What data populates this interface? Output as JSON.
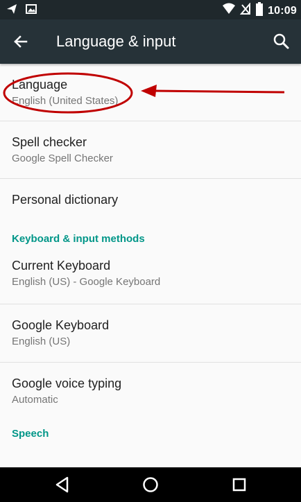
{
  "status_bar": {
    "time": "10:09",
    "icons": [
      "send-icon",
      "image-icon",
      "wifi-icon",
      "no-sim-icon",
      "battery-icon"
    ]
  },
  "app_bar": {
    "title": "Language & input",
    "back_icon": "arrow-left-icon",
    "search_icon": "search-icon"
  },
  "items": [
    {
      "title": "Language",
      "summary": "English (United States)"
    },
    {
      "title": "Spell checker",
      "summary": "Google Spell Checker"
    },
    {
      "title": "Personal dictionary"
    }
  ],
  "category_keyboard": {
    "label": "Keyboard & input methods",
    "items": [
      {
        "title": "Current Keyboard",
        "summary": "English (US) - Google Keyboard"
      },
      {
        "title": "Google Keyboard",
        "summary": "English (US)"
      },
      {
        "title": "Google voice typing",
        "summary": "Automatic"
      }
    ]
  },
  "category_speech": {
    "label": "Speech"
  },
  "nav_bar": {
    "icons": [
      "back-triangle-icon",
      "home-circle-icon",
      "recents-square-icon"
    ]
  },
  "colors": {
    "status_bar": "#1f282c",
    "app_bar": "#263238",
    "accent": "#009688",
    "annotation": "#c00000"
  }
}
